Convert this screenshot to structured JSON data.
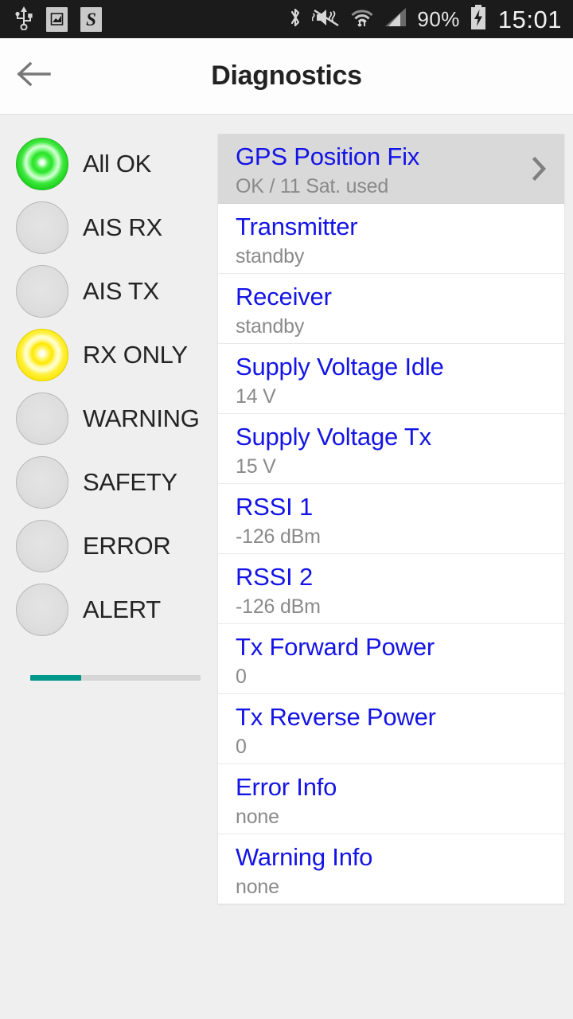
{
  "statusbar": {
    "left_icons": [
      "usb-icon",
      "screenshot-image-icon",
      "skype-s-icon"
    ],
    "right_icons": [
      "bluetooth-icon",
      "vibrate-mute-icon",
      "wifi-data-icon",
      "cellular-signal-icon"
    ],
    "battery_percent": "90%",
    "battery_state": "charging",
    "clock": "15:01"
  },
  "appbar": {
    "back_icon": "arrow-left-icon",
    "title": "Diagnostics"
  },
  "leds": {
    "items": [
      {
        "label": "All OK",
        "state": "green"
      },
      {
        "label": "AIS RX",
        "state": "off"
      },
      {
        "label": "AIS TX",
        "state": "off"
      },
      {
        "label": "RX ONLY",
        "state": "yellow"
      },
      {
        "label": "WARNING",
        "state": "off"
      },
      {
        "label": "SAFETY",
        "state": "off"
      },
      {
        "label": "ERROR",
        "state": "off"
      },
      {
        "label": "ALERT",
        "state": "off"
      }
    ],
    "progress": {
      "percent": 30,
      "fill_color": "#00968a",
      "track_color": "#d6d6d6"
    }
  },
  "list": {
    "rows": [
      {
        "title": "GPS Position Fix",
        "value": "OK / 11 Sat. used",
        "selected": true,
        "chevron": true
      },
      {
        "title": "Transmitter",
        "value": "standby",
        "selected": false,
        "chevron": false
      },
      {
        "title": "Receiver",
        "value": "standby",
        "selected": false,
        "chevron": false
      },
      {
        "title": "Supply Voltage Idle",
        "value": "14 V",
        "selected": false,
        "chevron": false
      },
      {
        "title": "Supply Voltage Tx",
        "value": "15 V",
        "selected": false,
        "chevron": false
      },
      {
        "title": "RSSI 1",
        "value": "-126 dBm",
        "selected": false,
        "chevron": false
      },
      {
        "title": "RSSI 2",
        "value": "-126 dBm",
        "selected": false,
        "chevron": false
      },
      {
        "title": "Tx Forward Power",
        "value": "0",
        "selected": false,
        "chevron": false
      },
      {
        "title": "Tx Reverse Power",
        "value": "0",
        "selected": false,
        "chevron": false
      },
      {
        "title": "Error Info",
        "value": "none",
        "selected": false,
        "chevron": false
      },
      {
        "title": "Warning Info",
        "value": "none",
        "selected": false,
        "chevron": false
      }
    ]
  },
  "colors": {
    "title_blue": "#1414e6",
    "value_gray": "#8a8a8a",
    "accent_teal": "#00968a",
    "led_green": "#27e327",
    "led_yellow": "#ffe800",
    "background": "#efefef"
  }
}
